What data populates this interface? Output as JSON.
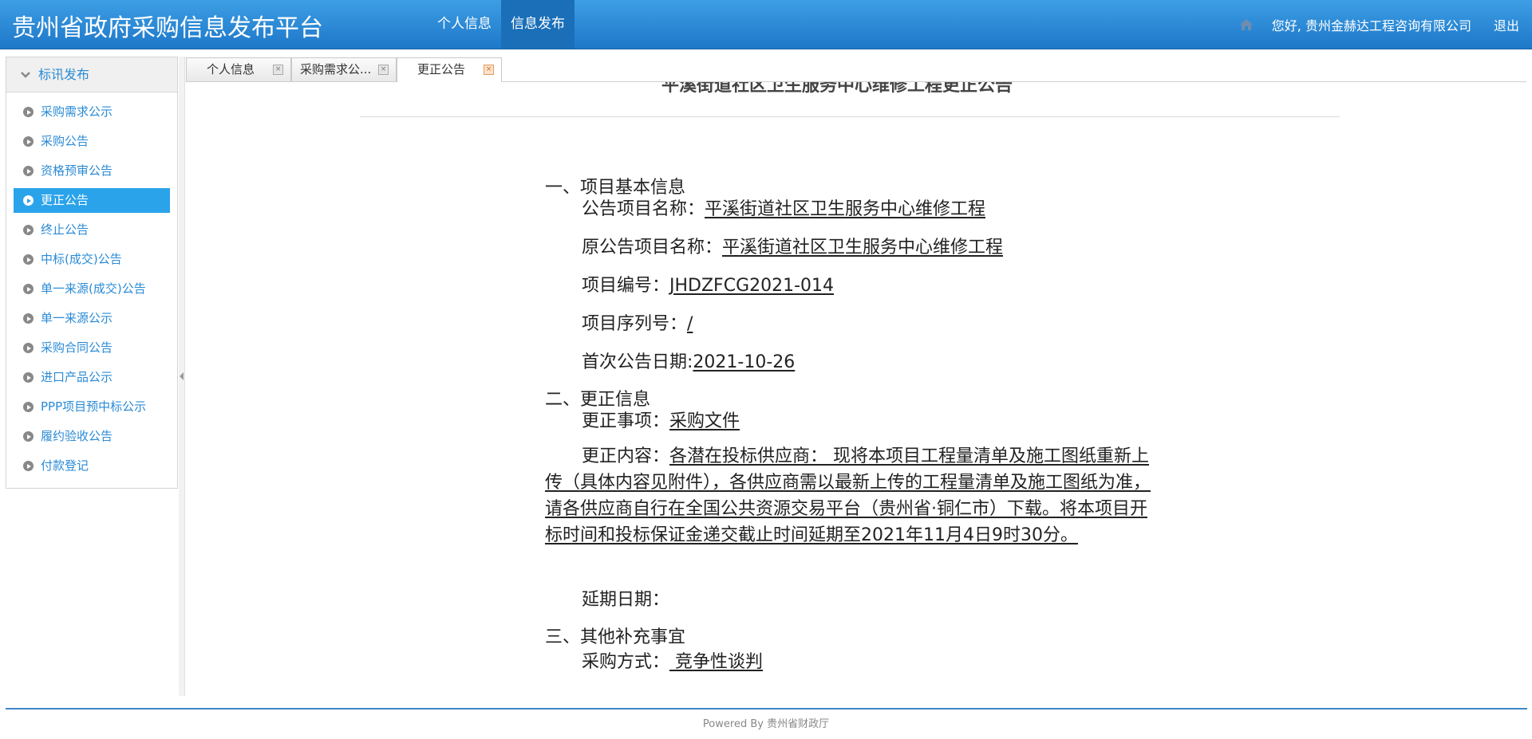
{
  "header": {
    "title": "贵州省政府采购信息发布平台",
    "nav": [
      "个人信息",
      "信息发布"
    ],
    "greeting": "您好, 贵州金赫达工程咨询有限公司",
    "logout": "退出"
  },
  "sidebar": {
    "header": "标讯发布",
    "items": [
      {
        "label": "采购需求公示"
      },
      {
        "label": "采购公告"
      },
      {
        "label": "资格预审公告"
      },
      {
        "label": "更正公告",
        "active": true
      },
      {
        "label": "终止公告"
      },
      {
        "label": "中标(成交)公告"
      },
      {
        "label": "单一来源(成交)公告"
      },
      {
        "label": "单一来源公示"
      },
      {
        "label": "采购合同公告"
      },
      {
        "label": "进口产品公示"
      },
      {
        "label": "PPP项目预中标公示"
      },
      {
        "label": "履约验收公告"
      },
      {
        "label": "付款登记"
      }
    ]
  },
  "tabs": [
    {
      "label": "个人信息"
    },
    {
      "label": "采购需求公..."
    },
    {
      "label": "更正公告",
      "active": true
    }
  ],
  "content": {
    "cut_title": "平溪街道社区卫生服务中心维修工程更正公告",
    "sec1": "一、项目基本信息",
    "project_name_label": "公告项目名称：",
    "project_name": "平溪街道社区卫生服务中心维修工程",
    "orig_name_label": "原公告项目名称：",
    "orig_name": "平溪街道社区卫生服务中心维修工程",
    "code_label": "项目编号：",
    "code": "JHDZFCG2021-014",
    "serial_label": "项目序列号：",
    "serial": "/",
    "first_date_label": "首次公告日期:",
    "first_date": "2021-10-26",
    "sec2": "二、更正信息",
    "item_label": "更正事项：",
    "item": "采购文件",
    "content_label": "更正内容：",
    "content_text": "各潜在投标供应商： 现将本项目工程量清单及施工图纸重新上传（具体内容见附件），各供应商需以最新上传的工程量清单及施工图纸为准，请各供应商自行在全国公共资源交易平台（贵州省·铜仁市）下载。将本项目开标时间和投标保证金递交截止时间延期至2021年11月4日9时30分。",
    "delay_label": "延期日期：",
    "sec3": "三、其他补充事宜",
    "method_label": "采购方式：",
    "method": " 竞争性谈判"
  },
  "footer": "Powered By 贵州省财政厅"
}
